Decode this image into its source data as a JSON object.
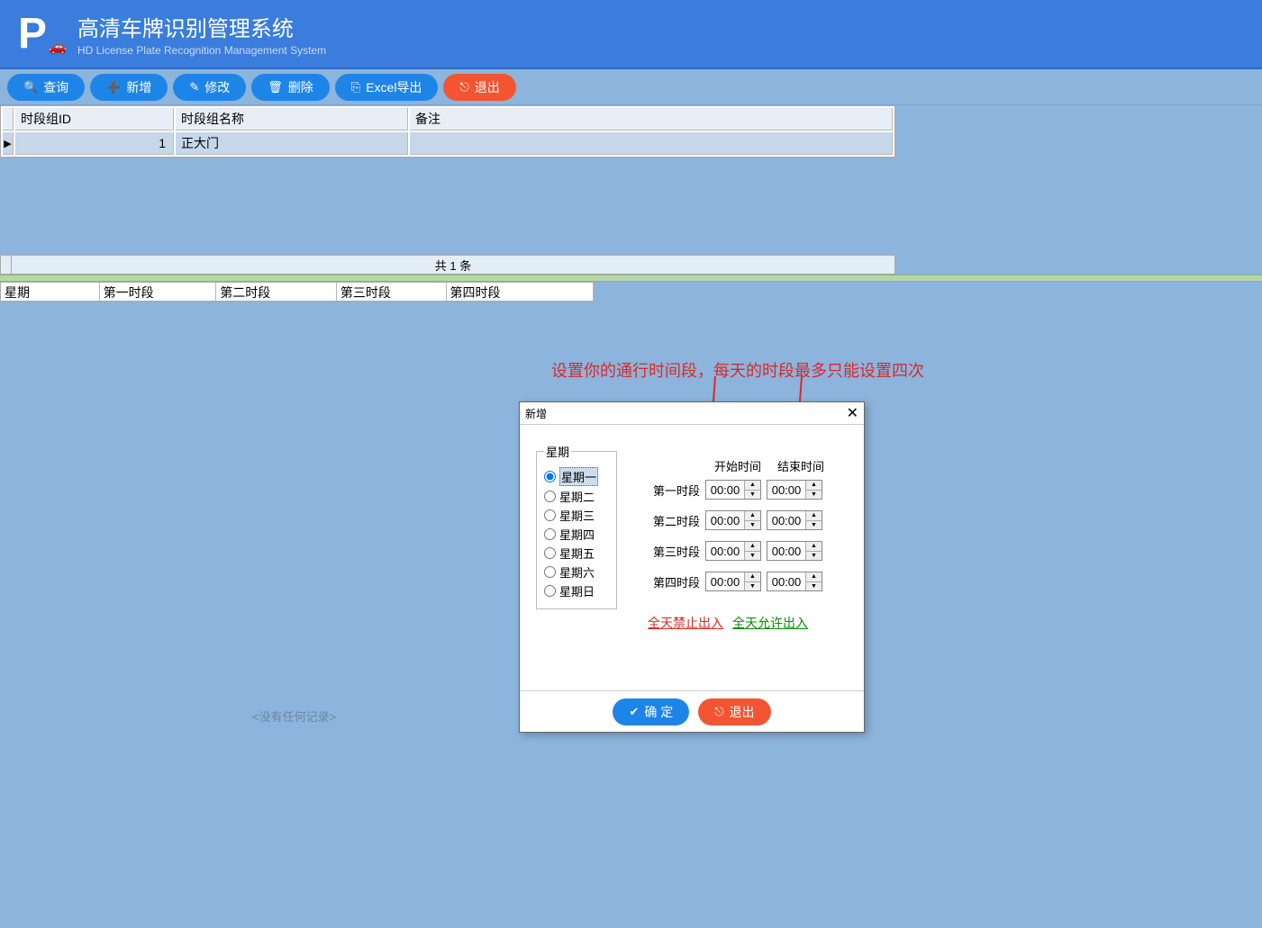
{
  "header": {
    "title": "高清车牌识别管理系统",
    "subtitle": "HD License Plate Recognition Management System"
  },
  "toolbar": {
    "search": "查询",
    "add": "新增",
    "edit": "修改",
    "delete": "删除",
    "export": "Excel导出",
    "exit": "退出"
  },
  "table": {
    "col_id": "时段组ID",
    "col_name": "时段组名称",
    "col_note": "备注",
    "rows": [
      {
        "id": "1",
        "name": "正大门",
        "note": ""
      }
    ],
    "count_label": "共 1 条"
  },
  "schedule_header": {
    "c0": "星期",
    "c1": "第一时段",
    "c2": "第二时段",
    "c3": "第三时段",
    "c4": "第四时段"
  },
  "no_record": "<没有任何记录>",
  "annotation": "设置你的通行时间段，每天的时段最多只能设置四次",
  "dialog": {
    "title": "新增",
    "weekday_legend": "星期",
    "weekdays": [
      "星期一",
      "星期二",
      "星期三",
      "星期四",
      "星期五",
      "星期六",
      "星期日"
    ],
    "start_time": "开始时间",
    "end_time": "结束时间",
    "periods": [
      {
        "label": "第一时段",
        "start": "00:00",
        "end": "00:00"
      },
      {
        "label": "第二时段",
        "start": "00:00",
        "end": "00:00"
      },
      {
        "label": "第三时段",
        "start": "00:00",
        "end": "00:00"
      },
      {
        "label": "第四时段",
        "start": "00:00",
        "end": "00:00"
      }
    ],
    "forbid_all": "全天禁止出入",
    "allow_all": "全天允许出入",
    "ok": "确 定",
    "exit": "退出"
  }
}
